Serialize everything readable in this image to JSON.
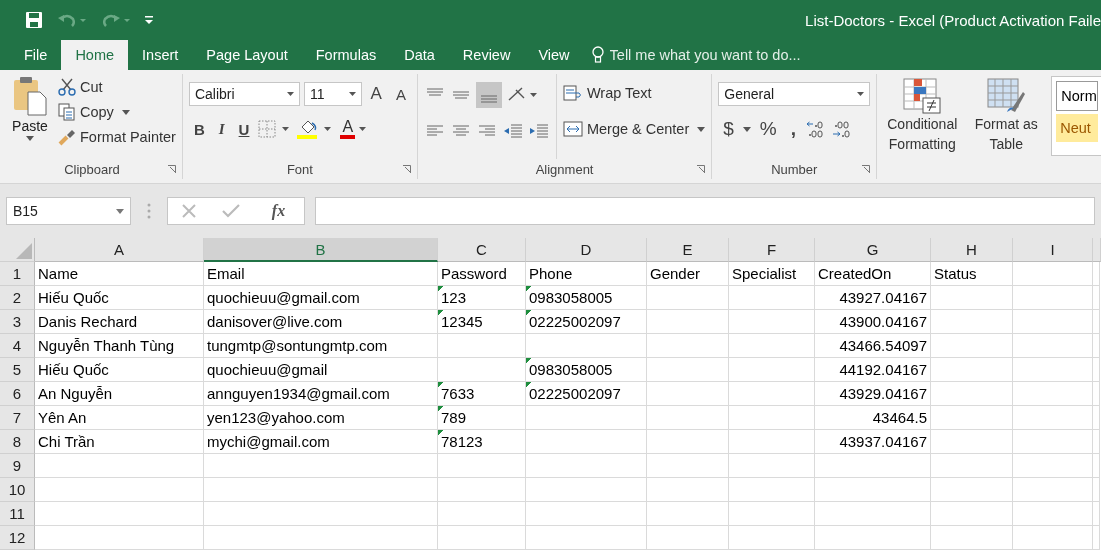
{
  "window": {
    "title": "List-Doctors - Excel (Product Activation Faile"
  },
  "tabs": [
    {
      "label": "File",
      "selected": false
    },
    {
      "label": "Home",
      "selected": true
    },
    {
      "label": "Insert",
      "selected": false
    },
    {
      "label": "Page Layout",
      "selected": false
    },
    {
      "label": "Formulas",
      "selected": false
    },
    {
      "label": "Data",
      "selected": false
    },
    {
      "label": "Review",
      "selected": false
    },
    {
      "label": "View",
      "selected": false
    }
  ],
  "tell_me": {
    "placeholder": "Tell me what you want to do..."
  },
  "clipboard": {
    "paste": "Paste",
    "cut": "Cut",
    "copy": "Copy",
    "format_painter": "Format Painter",
    "label": "Clipboard"
  },
  "font": {
    "family": "Calibri",
    "size": "11",
    "grow": "A",
    "shrink": "A",
    "bold": "B",
    "italic": "I",
    "underline": "U",
    "font_color_letter": "A",
    "label": "Font"
  },
  "alignment": {
    "wrap": "Wrap Text",
    "merge": "Merge & Center",
    "label": "Alignment"
  },
  "number": {
    "format": "General",
    "currency": "$",
    "percent": "%",
    "comma": ",",
    "label": "Number"
  },
  "styles": {
    "conditional": "Conditional Formatting",
    "format_table": "Format as Table",
    "normal": "Norm",
    "neutral": "Neut"
  },
  "formula_bar": {
    "name_box": "B15",
    "fx": "fx"
  },
  "sheet": {
    "columns": [
      {
        "label": "A",
        "selected": false
      },
      {
        "label": "B",
        "selected": true
      },
      {
        "label": "C",
        "selected": false
      },
      {
        "label": "D",
        "selected": false
      },
      {
        "label": "E",
        "selected": false
      },
      {
        "label": "F",
        "selected": false
      },
      {
        "label": "G",
        "selected": false
      },
      {
        "label": "H",
        "selected": false
      },
      {
        "label": "I",
        "selected": false
      }
    ],
    "rows": [
      {
        "number": "1",
        "cells": [
          {
            "text": "Name",
            "kind": "text"
          },
          {
            "text": "Email",
            "kind": "text"
          },
          {
            "text": "Password",
            "kind": "text"
          },
          {
            "text": "Phone",
            "kind": "text"
          },
          {
            "text": "Gender",
            "kind": "text"
          },
          {
            "text": "Specialist",
            "kind": "text"
          },
          {
            "text": "CreatedOn",
            "kind": "text"
          },
          {
            "text": "Status",
            "kind": "text"
          }
        ]
      },
      {
        "number": "2",
        "cells": [
          {
            "text": "Hiếu Quốc",
            "kind": "text"
          },
          {
            "text": "quochieuu@gmail.com",
            "kind": "text"
          },
          {
            "text": "123",
            "kind": "number-as-text"
          },
          {
            "text": "0983058005",
            "kind": "number-as-text"
          },
          null,
          null,
          {
            "text": "43927.04167",
            "kind": "number"
          }
        ]
      },
      {
        "number": "3",
        "cells": [
          {
            "text": "Danis Rechard",
            "kind": "text"
          },
          {
            "text": "danisover@live.com",
            "kind": "text"
          },
          {
            "text": "12345",
            "kind": "number-as-text"
          },
          {
            "text": "02225002097",
            "kind": "number-as-text"
          },
          null,
          null,
          {
            "text": "43900.04167",
            "kind": "number"
          }
        ]
      },
      {
        "number": "4",
        "cells": [
          {
            "text": "Nguyễn Thanh Tùng",
            "kind": "text"
          },
          {
            "text": "tungmtp@sontungmtp.com",
            "kind": "text"
          },
          null,
          null,
          null,
          null,
          {
            "text": "43466.54097",
            "kind": "number"
          }
        ]
      },
      {
        "number": "5",
        "cells": [
          {
            "text": "Hiếu Quốc",
            "kind": "text"
          },
          {
            "text": "quochieuu@gmail",
            "kind": "text"
          },
          null,
          {
            "text": "0983058005",
            "kind": "number-as-text"
          },
          null,
          null,
          {
            "text": "44192.04167",
            "kind": "number"
          }
        ]
      },
      {
        "number": "6",
        "cells": [
          {
            "text": "An Nguyễn",
            "kind": "text"
          },
          {
            "text": "annguyen1934@gmail.com",
            "kind": "text"
          },
          {
            "text": "7633",
            "kind": "number-as-text"
          },
          {
            "text": "02225002097",
            "kind": "number-as-text"
          },
          null,
          null,
          {
            "text": "43929.04167",
            "kind": "number"
          }
        ]
      },
      {
        "number": "7",
        "cells": [
          {
            "text": "Yên An",
            "kind": "text"
          },
          {
            "text": "yen123@yahoo.com",
            "kind": "text"
          },
          {
            "text": "789",
            "kind": "number-as-text"
          },
          null,
          null,
          null,
          {
            "text": "43464.5",
            "kind": "number"
          }
        ]
      },
      {
        "number": "8",
        "cells": [
          {
            "text": "Chi Trần",
            "kind": "text"
          },
          {
            "text": "mychi@gmail.com",
            "kind": "text"
          },
          {
            "text": "78123",
            "kind": "number-as-text"
          },
          null,
          null,
          null,
          {
            "text": "43937.04167",
            "kind": "number"
          }
        ]
      },
      {
        "number": "9"
      },
      {
        "number": "10"
      },
      {
        "number": "11"
      },
      {
        "number": "12"
      }
    ]
  }
}
